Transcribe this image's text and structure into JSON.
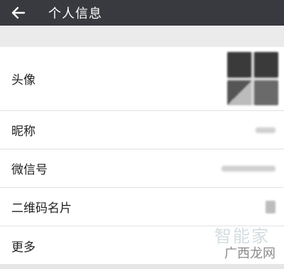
{
  "header": {
    "back_icon": "arrow-left-icon",
    "title": "个人信息"
  },
  "rows": [
    {
      "label": "头像"
    },
    {
      "label": "昵称"
    },
    {
      "label": "微信号"
    },
    {
      "label": "二维码名片"
    },
    {
      "label": "更多"
    }
  ],
  "watermark": {
    "top": "智能家",
    "bottom": "广西龙网"
  },
  "colors": {
    "header_bg": "#393a3f",
    "header_text": "#ffffff",
    "page_bg": "#f0f0f0"
  }
}
